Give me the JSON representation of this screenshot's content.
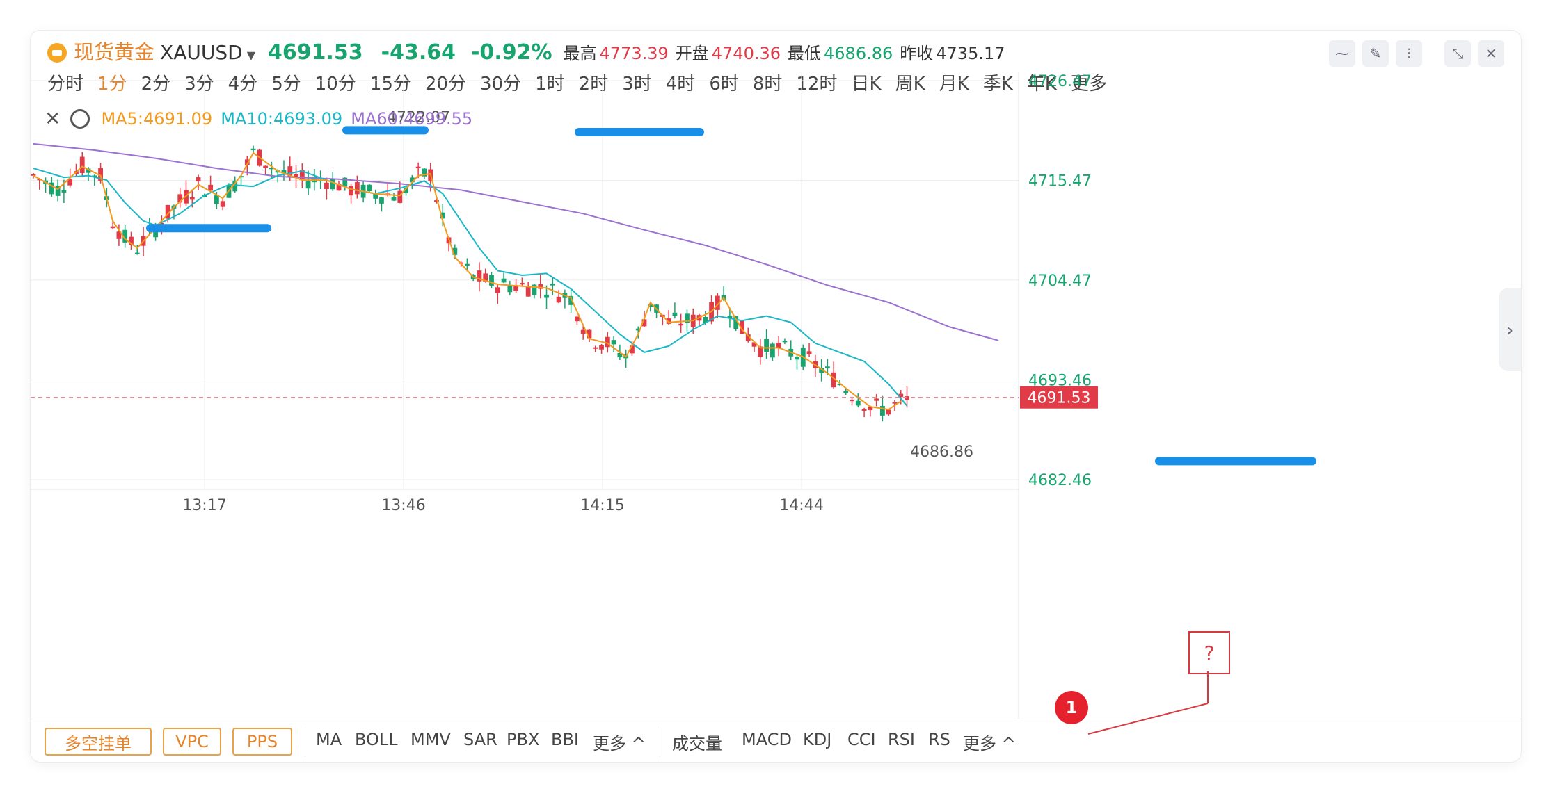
{
  "header": {
    "name": "现货黄金",
    "symbol": "XAUUSD",
    "last": "4691.53",
    "change": "-43.64",
    "change_pct": "-0.92%",
    "high_label": "最高",
    "high": "4773.39",
    "open_label": "开盘",
    "open": "4740.36",
    "low_label": "最低",
    "low": "4686.86",
    "prev_label": "昨收",
    "prev": "4735.17",
    "colors": {
      "up": "#e03b47",
      "down": "#17a46e",
      "accent": "#e5842a"
    }
  },
  "periods": [
    "分时",
    "1分",
    "2分",
    "3分",
    "4分",
    "5分",
    "10分",
    "15分",
    "20分",
    "30分",
    "1时",
    "2时",
    "3时",
    "4时",
    "6时",
    "8时",
    "12时",
    "日K",
    "周K",
    "月K",
    "季K",
    "年K",
    "更多"
  ],
  "active_period": "1分",
  "indicators": {
    "ma5": "MA5:4691.09",
    "ma10": "MA10:4693.09",
    "ma60": "MA60:4699.55"
  },
  "toolbar_bottom": {
    "boxes": [
      "多空挂单",
      "VPC",
      "PPS"
    ],
    "main_inds": [
      "MA",
      "BOLL",
      "MMV",
      "SAR",
      "PBX",
      "BBI",
      "更多 ^"
    ],
    "sub_inds": [
      "成交量",
      "MACD",
      "KDJ",
      "CCI",
      "RSI",
      "RS",
      "更多 ^"
    ]
  },
  "annotation": {
    "badge": "1",
    "question": "?"
  },
  "chart_data": {
    "type": "candlestick",
    "x_ticks": [
      "13:17",
      "13:46",
      "14:15",
      "14:44"
    ],
    "y_ticks": [
      "4726.47",
      "4715.47",
      "4704.47",
      "4693.46",
      "4682.46"
    ],
    "ylim": [
      4682.46,
      4726.47
    ],
    "last_price_label": "4691.53",
    "last_price": 4691.53,
    "marked_high": "4722.07",
    "marked_low": "4686.86",
    "series_names": [
      "MA5",
      "MA10",
      "MA60"
    ],
    "colors": {
      "up": "#e03b47",
      "down": "#17a46e",
      "ma5": "#f29a1d",
      "ma10": "#1bb7c6",
      "ma60": "#9b72cf",
      "marker": "#1a8fe8"
    },
    "ma60": [
      [
        0,
        4719.5
      ],
      [
        10,
        4718.8
      ],
      [
        20,
        4717.9
      ],
      [
        30,
        4716.8
      ],
      [
        40,
        4715.9
      ],
      [
        50,
        4715.6
      ],
      [
        60,
        4715.1
      ],
      [
        70,
        4714.4
      ],
      [
        80,
        4713.1
      ],
      [
        90,
        4711.8
      ],
      [
        100,
        4710.0
      ],
      [
        110,
        4708.3
      ],
      [
        120,
        4706.2
      ],
      [
        130,
        4703.9
      ],
      [
        140,
        4702.0
      ],
      [
        150,
        4699.3
      ],
      [
        158,
        4697.8
      ]
    ],
    "ma10": [
      [
        0,
        4716.8
      ],
      [
        5,
        4715.8
      ],
      [
        9,
        4716.0
      ],
      [
        12,
        4715.5
      ],
      [
        15,
        4713.0
      ],
      [
        18,
        4711.0
      ],
      [
        20,
        4710.5
      ],
      [
        24,
        4711.8
      ],
      [
        28,
        4713.8
      ],
      [
        32,
        4715.0
      ],
      [
        36,
        4714.8
      ],
      [
        40,
        4716.0
      ],
      [
        44,
        4716.5
      ],
      [
        48,
        4715.5
      ],
      [
        52,
        4714.5
      ],
      [
        56,
        4714.0
      ],
      [
        60,
        4714.6
      ],
      [
        64,
        4715.4
      ],
      [
        67,
        4714.0
      ],
      [
        70,
        4711.0
      ],
      [
        73,
        4708.0
      ],
      [
        76,
        4705.5
      ],
      [
        80,
        4705.0
      ],
      [
        84,
        4705.2
      ],
      [
        88,
        4703.5
      ],
      [
        92,
        4701.0
      ],
      [
        96,
        4698.5
      ],
      [
        100,
        4696.5
      ],
      [
        104,
        4697.2
      ],
      [
        108,
        4699.0
      ],
      [
        112,
        4700.5
      ],
      [
        116,
        4700.0
      ],
      [
        120,
        4700.5
      ],
      [
        124,
        4699.8
      ],
      [
        128,
        4697.5
      ],
      [
        132,
        4696.5
      ],
      [
        136,
        4695.5
      ],
      [
        140,
        4693.0
      ],
      [
        143,
        4690.6
      ]
    ],
    "ma5": [
      [
        0,
        4716.0
      ],
      [
        4,
        4714.5
      ],
      [
        8,
        4717.0
      ],
      [
        11,
        4716.0
      ],
      [
        13,
        4711.0
      ],
      [
        15,
        4709.0
      ],
      [
        17,
        4708.0
      ],
      [
        19,
        4709.5
      ],
      [
        23,
        4712.5
      ],
      [
        27,
        4715.0
      ],
      [
        31,
        4713.5
      ],
      [
        34,
        4716.0
      ],
      [
        36,
        4718.5
      ],
      [
        40,
        4716.5
      ],
      [
        44,
        4715.5
      ],
      [
        48,
        4715.5
      ],
      [
        52,
        4714.5
      ],
      [
        56,
        4714.0
      ],
      [
        60,
        4713.8
      ],
      [
        63,
        4716.0
      ],
      [
        65,
        4716.2
      ],
      [
        67,
        4711.0
      ],
      [
        69,
        4707.0
      ],
      [
        72,
        4704.8
      ],
      [
        76,
        4704.0
      ],
      [
        80,
        4703.8
      ],
      [
        84,
        4703.6
      ],
      [
        88,
        4702.5
      ],
      [
        91,
        4698.0
      ],
      [
        94,
        4697.5
      ],
      [
        97,
        4696.0
      ],
      [
        99,
        4698.5
      ],
      [
        101,
        4702.0
      ],
      [
        104,
        4699.8
      ],
      [
        108,
        4700.0
      ],
      [
        111,
        4701.0
      ],
      [
        113,
        4702.5
      ],
      [
        116,
        4699.0
      ],
      [
        119,
        4697.0
      ],
      [
        122,
        4697.0
      ],
      [
        126,
        4696.0
      ],
      [
        130,
        4694.2
      ],
      [
        134,
        4692.0
      ],
      [
        137,
        4690.5
      ],
      [
        140,
        4690.2
      ],
      [
        142,
        4691.1
      ]
    ]
  }
}
